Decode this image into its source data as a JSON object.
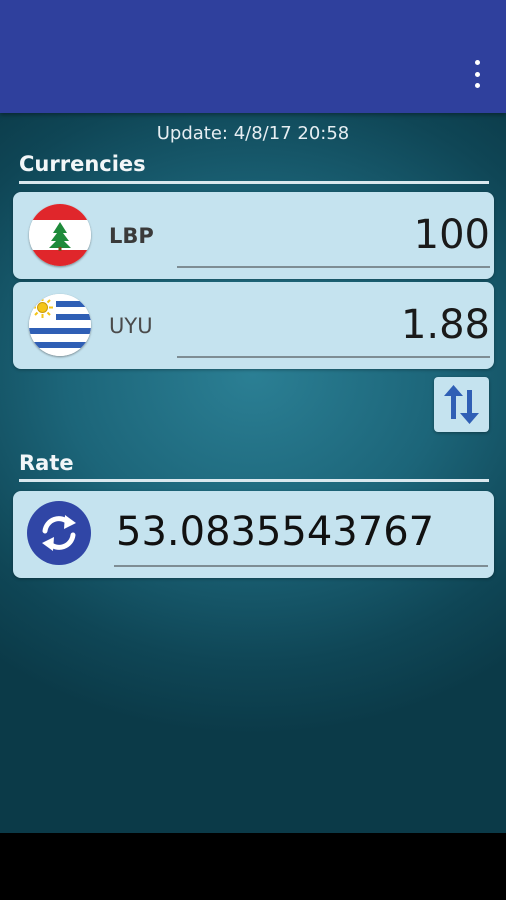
{
  "header": {
    "menu_icon": "more-vert-icon"
  },
  "update_text": "Update: 4/8/17 20:58",
  "currencies": {
    "title": "Currencies",
    "from": {
      "code": "LBP",
      "amount": "100",
      "flag_icon": "lebanon-flag-icon"
    },
    "to": {
      "code": "UYU",
      "amount": "1.88",
      "flag_icon": "uruguay-flag-icon"
    }
  },
  "swap": {
    "icon": "swap-arrows-icon"
  },
  "rate": {
    "title": "Rate",
    "value": "53.0835543767",
    "icon": "refresh-icon"
  },
  "colors": {
    "appbar": "#2f409d",
    "card": "#c5e3ef",
    "accent": "#3046a6"
  }
}
